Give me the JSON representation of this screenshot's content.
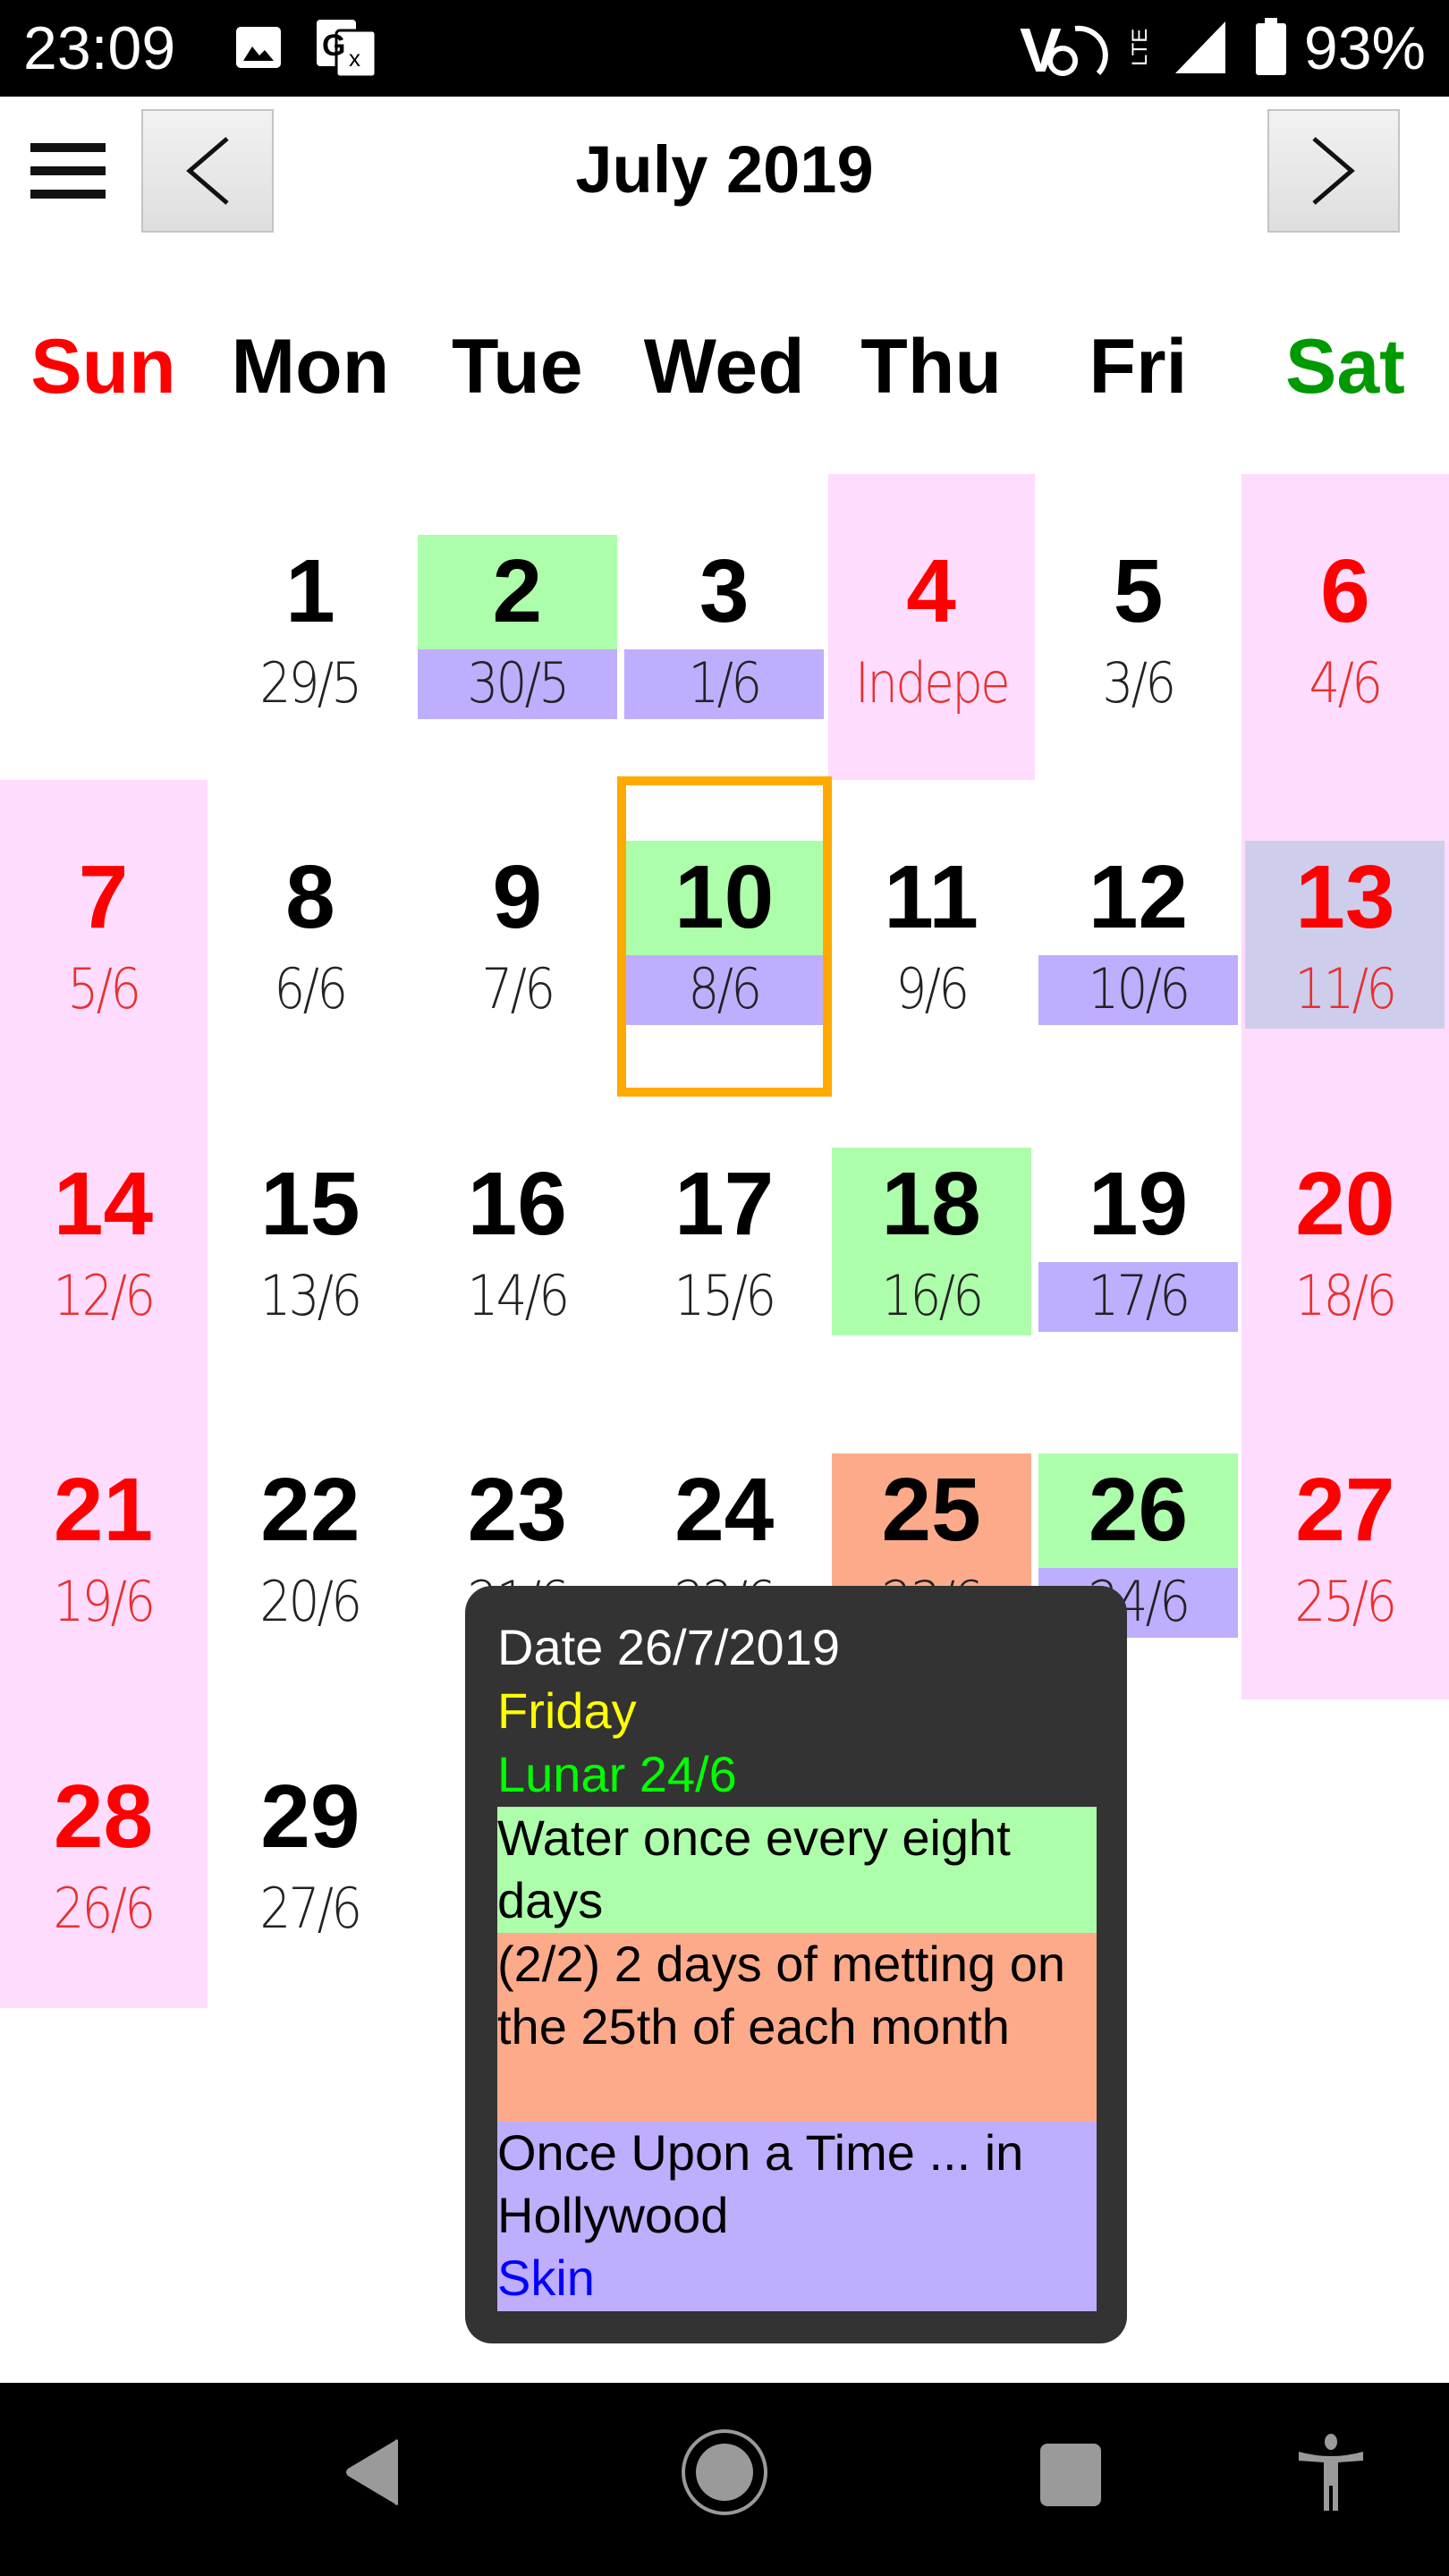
{
  "status_bar": {
    "time": "23:09",
    "notification_icons": [
      "gallery-icon",
      "translate-icon"
    ],
    "network_label": "VoLTE",
    "battery": "93%"
  },
  "header": {
    "menu_icon": "hamburger-menu-icon",
    "prev_label": "<",
    "next_label": ">",
    "title": "July 2019"
  },
  "weekdays": [
    {
      "label": "Sun",
      "color": "#ff0000"
    },
    {
      "label": "Mon",
      "color": "#000000"
    },
    {
      "label": "Tue",
      "color": "#000000"
    },
    {
      "label": "Wed",
      "color": "#000000"
    },
    {
      "label": "Thu",
      "color": "#000000"
    },
    {
      "label": "Fri",
      "color": "#000000"
    },
    {
      "label": "Sat",
      "color": "#009900"
    }
  ],
  "colors": {
    "weekend_bg": "#fddcfd",
    "event_green": "#adfeaa",
    "event_purple": "#bfadfd",
    "event_orange": "#fdaa8a",
    "today_border": "#ffaa00",
    "sat_overlap": "#cfcdec",
    "tooltip_bg": "#333333",
    "tooltip_weekday": "#ffff00",
    "tooltip_lunar": "#00ff00",
    "tooltip_link": "#0000ff"
  },
  "calendar": {
    "today": 10,
    "days": [
      {
        "day": "1",
        "lunar": "29/5",
        "col": 1,
        "row": 0
      },
      {
        "day": "2",
        "lunar": "30/5",
        "col": 2,
        "row": 0,
        "top": "green",
        "bottom": "purple"
      },
      {
        "day": "3",
        "lunar": "1/6",
        "col": 3,
        "row": 0,
        "bottom": "purple"
      },
      {
        "day": "4",
        "lunar": "Indepe",
        "col": 4,
        "row": 0,
        "holiday": true
      },
      {
        "day": "5",
        "lunar": "3/6",
        "col": 5,
        "row": 0
      },
      {
        "day": "6",
        "lunar": "4/6",
        "col": 6,
        "row": 0
      },
      {
        "day": "7",
        "lunar": "5/6",
        "col": 0,
        "row": 1
      },
      {
        "day": "8",
        "lunar": "6/6",
        "col": 1,
        "row": 1
      },
      {
        "day": "9",
        "lunar": "7/6",
        "col": 2,
        "row": 1
      },
      {
        "day": "10",
        "lunar": "8/6",
        "col": 3,
        "row": 1,
        "top": "green",
        "bottom": "purple"
      },
      {
        "day": "11",
        "lunar": "9/6",
        "col": 4,
        "row": 1
      },
      {
        "day": "12",
        "lunar": "10/6",
        "col": 5,
        "row": 1,
        "bottom": "purple"
      },
      {
        "day": "13",
        "lunar": "11/6",
        "col": 6,
        "row": 1,
        "full": "sat_overlap"
      },
      {
        "day": "14",
        "lunar": "12/6",
        "col": 0,
        "row": 2
      },
      {
        "day": "15",
        "lunar": "13/6",
        "col": 1,
        "row": 2
      },
      {
        "day": "16",
        "lunar": "14/6",
        "col": 2,
        "row": 2
      },
      {
        "day": "17",
        "lunar": "15/6",
        "col": 3,
        "row": 2
      },
      {
        "day": "18",
        "lunar": "16/6",
        "col": 4,
        "row": 2,
        "full": "green"
      },
      {
        "day": "19",
        "lunar": "17/6",
        "col": 5,
        "row": 2,
        "bottom": "purple"
      },
      {
        "day": "20",
        "lunar": "18/6",
        "col": 6,
        "row": 2
      },
      {
        "day": "21",
        "lunar": "19/6",
        "col": 0,
        "row": 3
      },
      {
        "day": "22",
        "lunar": "20/6",
        "col": 1,
        "row": 3
      },
      {
        "day": "23",
        "lunar": "21/6",
        "col": 2,
        "row": 3
      },
      {
        "day": "24",
        "lunar": "22/6",
        "col": 3,
        "row": 3
      },
      {
        "day": "25",
        "lunar": "23/6",
        "col": 4,
        "row": 3,
        "full": "orange"
      },
      {
        "day": "26",
        "lunar": "24/6",
        "col": 5,
        "row": 3,
        "top": "green",
        "bottom": "purple"
      },
      {
        "day": "27",
        "lunar": "25/6",
        "col": 6,
        "row": 3
      },
      {
        "day": "28",
        "lunar": "26/6",
        "col": 0,
        "row": 4
      },
      {
        "day": "29",
        "lunar": "27/6",
        "col": 1,
        "row": 4
      }
    ]
  },
  "tooltip": {
    "date": "Date 26/7/2019",
    "weekday": "Friday",
    "lunar": "Lunar 24/6",
    "events": [
      {
        "text": "Water once every eight days",
        "color": "green"
      },
      {
        "text": "(2/2) 2 days of metting on the 25th of each month",
        "color": "orange"
      },
      {
        "text": "Once Upon a Time ... in Hollywood",
        "color": "purple",
        "link": "Skin"
      }
    ]
  },
  "system_nav": {
    "back": "back-icon",
    "home": "home-icon",
    "recents": "recents-icon",
    "accessibility": "accessibility-icon"
  }
}
